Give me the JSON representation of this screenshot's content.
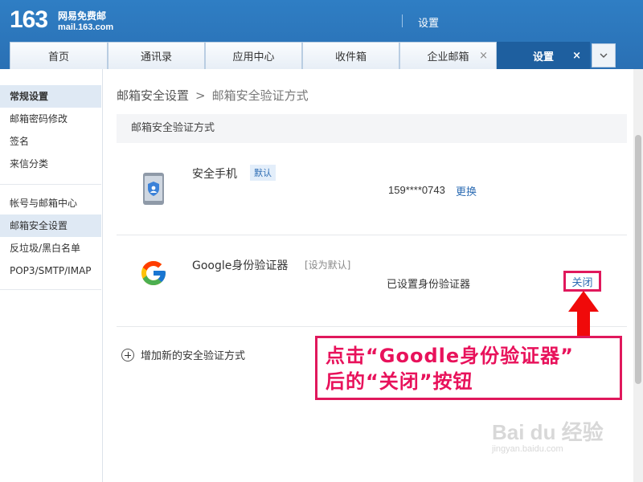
{
  "header": {
    "logo_number": "163",
    "logo_name": "网易免费邮",
    "logo_domain": "mail.163.com",
    "title": "设置"
  },
  "tabs": [
    {
      "label": "首页",
      "closable": false
    },
    {
      "label": "通讯录",
      "closable": false
    },
    {
      "label": "应用中心",
      "closable": false
    },
    {
      "label": "收件箱",
      "closable": false
    },
    {
      "label": "企业邮箱",
      "closable": true
    },
    {
      "label": "设置",
      "closable": true,
      "active": true
    }
  ],
  "tab_close_glyph": "×",
  "tab_more_icon": "chevron-down-icon",
  "sidebar": {
    "group1": [
      "常规设置",
      "邮箱密码修改",
      "签名",
      "来信分类"
    ],
    "group2": [
      "帐号与邮箱中心",
      "邮箱安全设置",
      "反垃圾/黑白名单",
      "POP3/SMTP/IMAP"
    ],
    "active": "邮箱安全设置"
  },
  "main": {
    "breadcrumb_parent": "邮箱安全设置",
    "breadcrumb_sep": ">",
    "breadcrumb_current": "邮箱安全验证方式",
    "section_title": "邮箱安全验证方式",
    "method1": {
      "icon": "phone-shield-icon",
      "title": "安全手机",
      "badge": "默认",
      "value": "159****0743",
      "link": "更换"
    },
    "method2": {
      "icon": "google-icon",
      "title": "Google身份验证器",
      "set_default": "[设为默认]",
      "status": "已设置身份验证器",
      "link": "关闭"
    },
    "add_label": "增加新的安全验证方式"
  },
  "annotation": {
    "line1": "点击“Goodle身份验证器”",
    "line2": "后的“关闭”按钮",
    "color": "#e0185c"
  },
  "watermark": {
    "main": "Bai du 经验",
    "sub": "jingyan.baidu.com"
  }
}
